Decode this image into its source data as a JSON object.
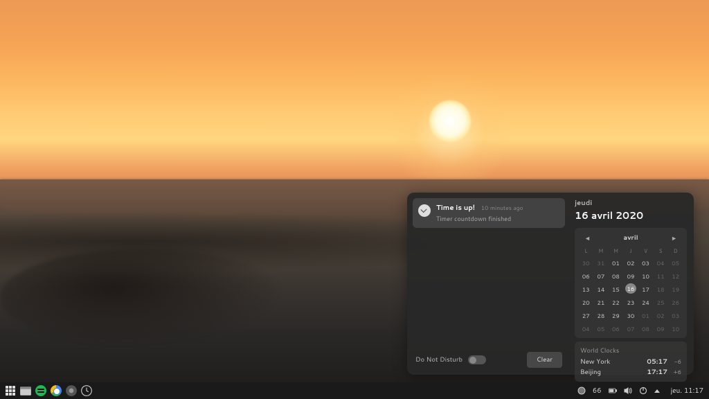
{
  "notification": {
    "title": "Time is up!",
    "time_ago": "10 minutes ago",
    "description": "Timer countdown finished"
  },
  "dnd": {
    "label": "Do Not Disturb"
  },
  "clear_label": "Clear",
  "calendar": {
    "weekday": "jeudi",
    "full_date": "16 avril 2020",
    "month_label": "avril",
    "dow": [
      "L",
      "M",
      "M",
      "J",
      "V",
      "S",
      "D"
    ],
    "weeks": [
      [
        {
          "d": "30",
          "mute": true
        },
        {
          "d": "31",
          "mute": true
        },
        {
          "d": "01"
        },
        {
          "d": "02"
        },
        {
          "d": "03"
        },
        {
          "d": "04",
          "mute": true
        },
        {
          "d": "05",
          "mute": true
        }
      ],
      [
        {
          "d": "06"
        },
        {
          "d": "07"
        },
        {
          "d": "08"
        },
        {
          "d": "09"
        },
        {
          "d": "10"
        },
        {
          "d": "11",
          "mute": true
        },
        {
          "d": "12",
          "mute": true
        }
      ],
      [
        {
          "d": "13"
        },
        {
          "d": "14"
        },
        {
          "d": "15"
        },
        {
          "d": "16",
          "today": true
        },
        {
          "d": "17"
        },
        {
          "d": "18",
          "mute": true
        },
        {
          "d": "19",
          "mute": true
        }
      ],
      [
        {
          "d": "20"
        },
        {
          "d": "21"
        },
        {
          "d": "22"
        },
        {
          "d": "23"
        },
        {
          "d": "24"
        },
        {
          "d": "25",
          "mute": true
        },
        {
          "d": "26",
          "mute": true
        }
      ],
      [
        {
          "d": "27"
        },
        {
          "d": "28"
        },
        {
          "d": "29"
        },
        {
          "d": "30"
        },
        {
          "d": "01",
          "mute": true
        },
        {
          "d": "02",
          "mute": true
        },
        {
          "d": "03",
          "mute": true
        }
      ],
      [
        {
          "d": "04",
          "mute": true
        },
        {
          "d": "05",
          "mute": true
        },
        {
          "d": "06",
          "mute": true
        },
        {
          "d": "07",
          "mute": true
        },
        {
          "d": "08",
          "mute": true
        },
        {
          "d": "09",
          "mute": true
        },
        {
          "d": "10",
          "mute": true
        }
      ]
    ]
  },
  "world_clocks": {
    "title": "World Clocks",
    "rows": [
      {
        "city": "New York",
        "time": "05:17",
        "offset": "-6"
      },
      {
        "city": "Beijing",
        "time": "17:17",
        "offset": "+6"
      }
    ]
  },
  "taskbar": {
    "battery": "66",
    "datetime": "jeu. 11:17"
  }
}
